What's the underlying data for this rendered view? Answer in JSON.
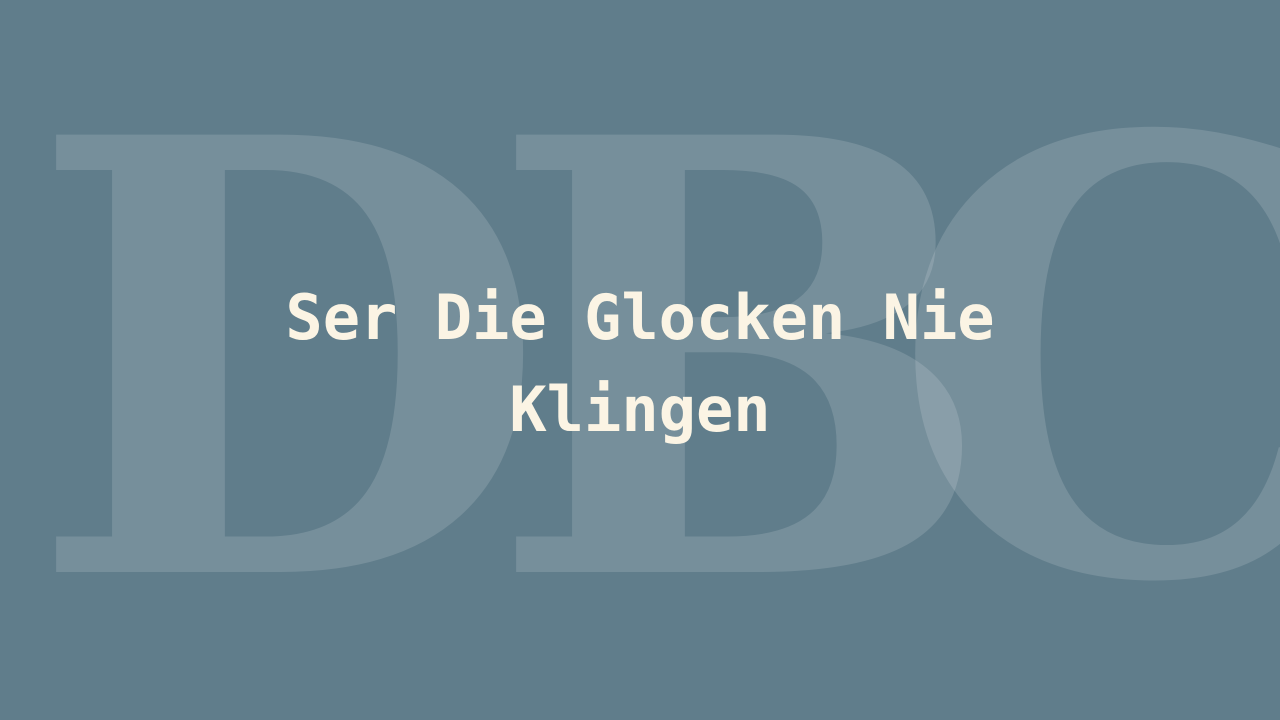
{
  "backdrop": {
    "letters": [
      "D",
      "B",
      "C"
    ]
  },
  "title": "Ser Die Glocken Nie Klingen",
  "colors": {
    "background": "#607d8b",
    "title_text": "#fbf4e4"
  }
}
